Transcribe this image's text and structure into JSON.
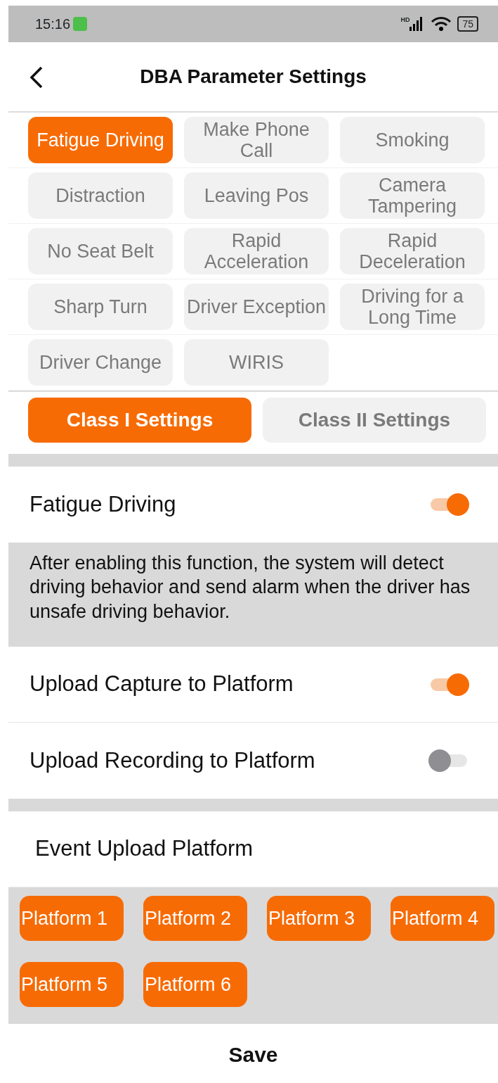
{
  "status_bar": {
    "time": "15:16",
    "network": "HD",
    "battery": "75"
  },
  "header": {
    "title": "DBA Parameter Settings"
  },
  "event_types": [
    {
      "label": "Fatigue Driving",
      "selected": true
    },
    {
      "label": "Make Phone Call",
      "selected": false
    },
    {
      "label": "Smoking",
      "selected": false
    },
    {
      "label": "Distraction",
      "selected": false
    },
    {
      "label": "Leaving Pos",
      "selected": false
    },
    {
      "label": "Camera Tampering",
      "selected": false
    },
    {
      "label": "No Seat Belt",
      "selected": false
    },
    {
      "label": "Rapid Acceleration",
      "selected": false
    },
    {
      "label": "Rapid Deceleration",
      "selected": false
    },
    {
      "label": "Sharp Turn",
      "selected": false
    },
    {
      "label": "Driver Exception",
      "selected": false
    },
    {
      "label": "Driving for a Long Time",
      "selected": false
    },
    {
      "label": "Driver Change",
      "selected": false
    },
    {
      "label": "WIRIS",
      "selected": false
    }
  ],
  "settings_tabs": [
    {
      "label": "Class I Settings",
      "selected": true
    },
    {
      "label": "Class II Settings",
      "selected": false
    }
  ],
  "main_toggle": {
    "label": "Fatigue Driving",
    "on": true
  },
  "description": "After enabling this function, the system will detect driving behavior and send alarm when the driver has unsafe driving behavior.",
  "upload_options": [
    {
      "label": "Upload Capture to Platform",
      "on": true
    },
    {
      "label": "Upload Recording to Platform",
      "on": false
    }
  ],
  "platform_section": {
    "title": "Event Upload Platform",
    "platforms": [
      {
        "label": "Platform 1",
        "selected": true
      },
      {
        "label": "Platform 2",
        "selected": true
      },
      {
        "label": "Platform 3",
        "selected": true
      },
      {
        "label": "Platform 4",
        "selected": true
      },
      {
        "label": "Platform 5",
        "selected": true
      },
      {
        "label": "Platform 6",
        "selected": true
      }
    ]
  },
  "save_button": "Save"
}
